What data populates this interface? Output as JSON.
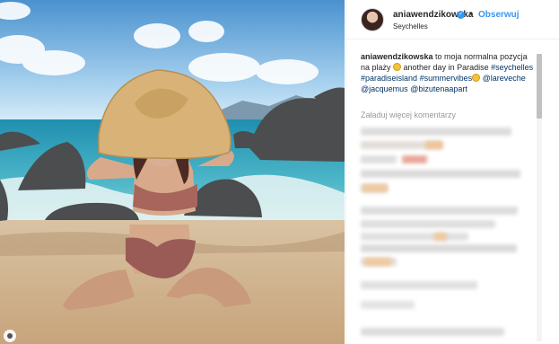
{
  "post": {
    "username": "aniawendzikowska",
    "follow_label": "Obserwuj",
    "separator": "•",
    "location": "Seychelles"
  },
  "caption": {
    "username": "aniawendzikowska",
    "text1": " to moja normalna pozycja na plaży ",
    "text2": " another day in Paradise ",
    "tag1": "#seychelles",
    "tag2": "#paradiseisland",
    "tag3": "#summervibes",
    "mention1": "@lareveche",
    "mention2": "@jacquemus",
    "mention3": "@bizutenaapart"
  },
  "comments": {
    "load_more_label": "Załaduj więcej komentarzy"
  },
  "icons": {
    "verified": "verified-badge-icon",
    "emoji1": "grinning-face-icon",
    "emoji2": "sun-icon"
  },
  "colors": {
    "link_blue": "#3897f0",
    "hashtag": "#003569",
    "muted": "#999999"
  }
}
